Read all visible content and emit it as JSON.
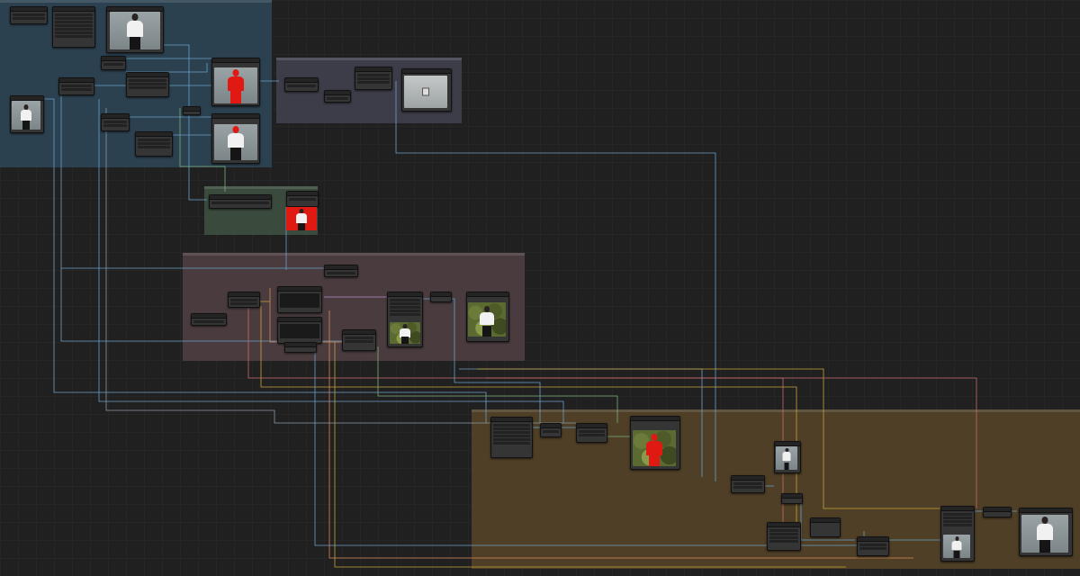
{
  "canvas": {
    "name": "node-graph-canvas"
  },
  "groups": [
    {
      "id": "g-input",
      "title": "",
      "color": "#2c4150"
    },
    {
      "id": "g-doc",
      "title": "",
      "color": "#3d3d49"
    },
    {
      "id": "g-mask",
      "title": "",
      "color": "#3a4a3c"
    },
    {
      "id": "g-gen",
      "title": "",
      "color": "#4a3c3e"
    },
    {
      "id": "g-composite",
      "title": "",
      "color": "#4e3f26"
    }
  ],
  "previews": [
    {
      "id": "p1",
      "kind": "person-on-grey"
    },
    {
      "id": "p2",
      "kind": "person-red-mask"
    },
    {
      "id": "p3",
      "kind": "person-red-head"
    },
    {
      "id": "p4",
      "kind": "person-small"
    },
    {
      "id": "p5",
      "kind": "document-icon"
    },
    {
      "id": "p6",
      "kind": "person-on-red"
    },
    {
      "id": "p7",
      "kind": "person-on-foliage"
    },
    {
      "id": "p8",
      "kind": "person-on-foliage"
    },
    {
      "id": "p9",
      "kind": "red-mask-on-foliage"
    },
    {
      "id": "p10",
      "kind": "person-on-light"
    },
    {
      "id": "p11",
      "kind": "person-on-grey"
    },
    {
      "id": "p12",
      "kind": "person-on-grey"
    }
  ],
  "wire_colors": {
    "image": "#6aa0c8",
    "mask": "#7bb07a",
    "latent": "#d88b5a",
    "clip": "#c9a23a",
    "model": "#b58ad0",
    "conditioning": "#c86a6a",
    "vae": "#d05050"
  }
}
